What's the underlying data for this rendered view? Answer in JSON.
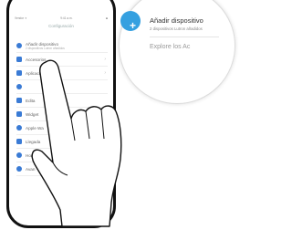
{
  "status_bar": {
    "carrier": "Vendor ✈",
    "time": "9:41 a.m.",
    "battery": "■"
  },
  "screen": {
    "title": "Configuración"
  },
  "menu": {
    "items": [
      {
        "label": "Añadir dispositivo",
        "sublabel": "2 dispositivos Lutron añadidos",
        "icon": "plus-icon"
      },
      {
        "label": "Accesorios",
        "icon": "cart-icon"
      },
      {
        "label": "Aplicación",
        "icon": "phone-icon"
      },
      {
        "label": "",
        "icon": "drop-icon"
      },
      {
        "label": "Edita",
        "icon": "edit-icon"
      },
      {
        "label": "Widget",
        "icon": "widget-icon"
      },
      {
        "label": "Apple Wa",
        "icon": "watch-icon"
      },
      {
        "label": "Llegada",
        "icon": "arrow-icon"
      },
      {
        "label": "Horario",
        "icon": "clock-icon"
      },
      {
        "label": "Avan",
        "icon": "gear-icon"
      }
    ]
  },
  "bubble": {
    "plus_symbol": "+",
    "title": "Añadir dispositivo",
    "subtitle": "2 dispositivos Lutron añadidos",
    "explore": "Explore los Ac"
  },
  "colors": {
    "accent": "#35a0e0",
    "menu_icon": "#3a7bd5"
  }
}
